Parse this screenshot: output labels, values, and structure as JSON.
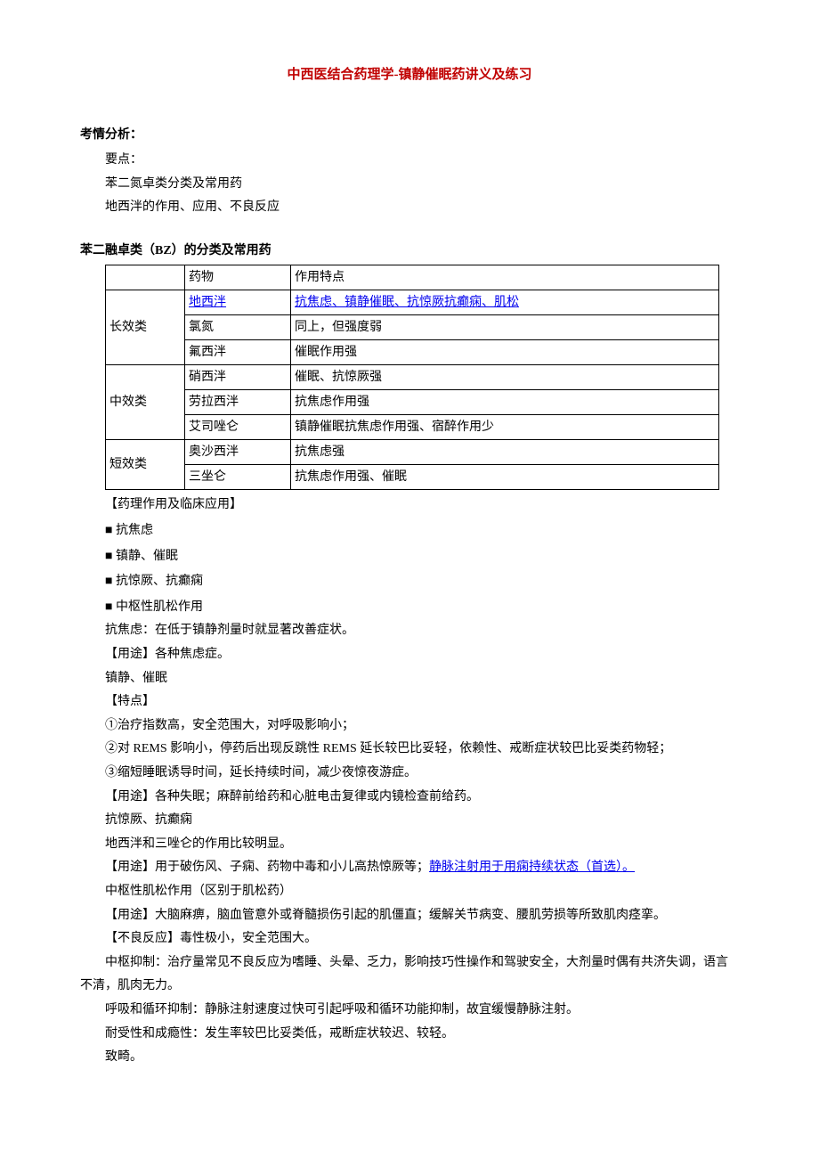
{
  "title": "中西医结合药理学-镇静催眠药讲义及练习",
  "analysis": {
    "heading": "考情分析：",
    "l1": "要点：",
    "l2": "苯二氮卓类分类及常用药",
    "l3": "地西泮的作用、应用、不良反应"
  },
  "tableHeading": "苯二融卓类（BZ）的分类及常用药",
  "tbl": {
    "h1": "药物",
    "h2": "作用特点",
    "g1": "长效类",
    "r1c1": "地西泮",
    "r1c2": "抗焦虑、镇静催眠、抗惊厥抗癫痫、肌松",
    "r2c1": "氯氮",
    "r2c2": "同上，但强度弱",
    "r3c1": "氟西泮",
    "r3c2": "催眠作用强",
    "g2": "中效类",
    "r4c1": "硝西泮",
    "r4c2": "催眠、抗惊厥强",
    "r5c1": "劳拉西泮",
    "r5c2": "抗焦虑作用强",
    "r6c1": "艾司唑仑",
    "r6c2": "镇静催眠抗焦虑作用强、宿醉作用少",
    "g3": "短效类",
    "r7c1": "奥沙西泮",
    "r7c2": "抗焦虑强",
    "r8c1": "三坐仑",
    "r8c2": "抗焦虑作用强、催眠"
  },
  "body": {
    "p1": "【药理作用及临床应用】",
    "b1": "■  抗焦虑",
    "b2": "■  镇静、催眠",
    "b3": "■  抗惊厥、抗癫痫",
    "b4": "■  中枢性肌松作用",
    "p2": "抗焦虑：在低于镇静剂量时就显著改善症状。",
    "p3": "【用途】各种焦虑症。",
    "p4": "镇静、催眠",
    "p5": "【特点】",
    "p6": "①治疗指数高，安全范围大，对呼吸影响小；",
    "p7": "②对 REMS 影响小，停药后出现反跳性 REMS 延长较巴比妥轻，依赖性、戒断症状较巴比妥类药物轻；",
    "p8": "③缩短睡眠诱导时间，延长持续时间，减少夜惊夜游症。",
    "p9": "【用途】各种失眠；麻醉前给药和心脏电击复律或内镜检查前给药。",
    "p10": "抗惊厥、抗癫痫",
    "p11": "地西泮和三唑仑的作用比较明显。",
    "p12a": "【用途】用于破伤风、子痫、药物中毒和小儿高热惊厥等；",
    "p12b": "静脉注射用于用痫持续状态（首选）。",
    "p13": "中枢性肌松作用（区别于肌松药）",
    "p14": "【用途】大脑麻痹，脑血管意外或脊髓损伤引起的肌僵直；缓解关节病变、腰肌劳损等所致肌肉痉挛。",
    "p15": "【不良反应】毒性极小，安全范围大。",
    "p16": "中枢抑制：治疗量常见不良反应为嗜睡、头晕、乏力，影响技巧性操作和驾驶安全，大剂量时偶有共济失调，语言不清，肌肉无力。",
    "p17": "呼吸和循环抑制：静脉注射速度过快可引起呼吸和循环功能抑制，故宜缓慢静脉注射。",
    "p18": "耐受性和成瘾性：发生率较巴比妥类低，戒断症状较迟、较轻。",
    "p19": "致畸。"
  }
}
